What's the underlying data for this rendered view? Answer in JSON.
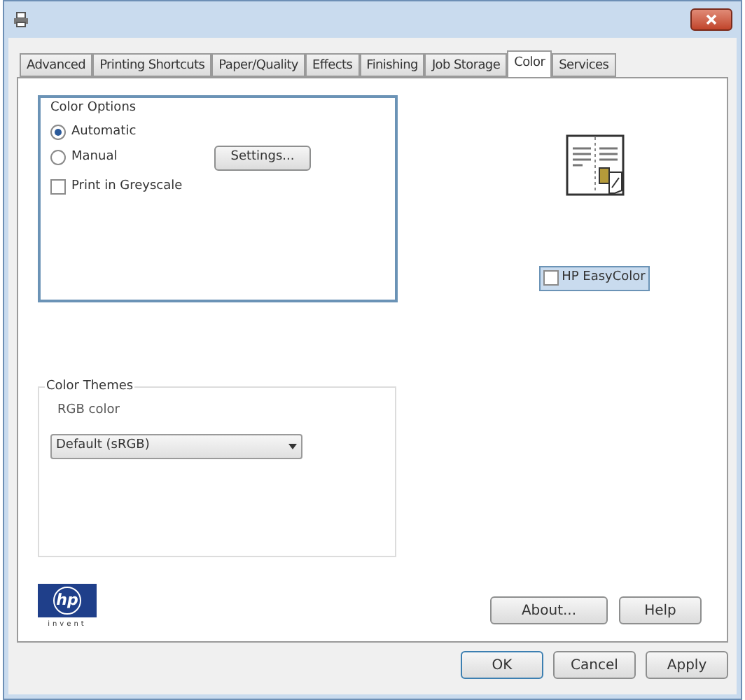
{
  "tabs": [
    {
      "label": "Advanced",
      "selected": false
    },
    {
      "label": "Printing Shortcuts",
      "selected": false
    },
    {
      "label": "Paper/Quality",
      "selected": false
    },
    {
      "label": "Effects",
      "selected": false
    },
    {
      "label": "Finishing",
      "selected": false
    },
    {
      "label": "Job Storage",
      "selected": false
    },
    {
      "label": "Color",
      "selected": true
    },
    {
      "label": "Services",
      "selected": false
    }
  ],
  "color_options": {
    "title": "Color Options",
    "modes": [
      {
        "label": "Automatic",
        "selected": true
      },
      {
        "label": "Manual",
        "selected": false
      }
    ],
    "settings_button": "Settings...",
    "greyscale": {
      "label": "Print in Greyscale",
      "checked": false
    }
  },
  "easycolor": {
    "label": "HP EasyColor",
    "checked": false
  },
  "color_themes": {
    "title": "Color Themes",
    "label": "RGB color",
    "value": "Default (sRGB)"
  },
  "logo": {
    "mark": "hp",
    "tagline": "invent"
  },
  "buttons": [
    "About...",
    "Help"
  ],
  "dialog_buttons": [
    "OK",
    "Cancel",
    "Apply"
  ]
}
